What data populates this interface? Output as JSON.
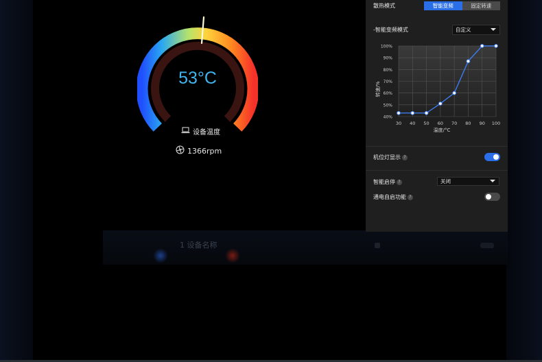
{
  "gauge": {
    "temperature": "53°C",
    "device_label": "设备温度",
    "fan_speed": "1366rpm",
    "level_fraction": 0.53,
    "icons": [
      "laptop-icon",
      "fan-icon"
    ]
  },
  "panel": {
    "cooling_mode_label": "散热模式",
    "mode_tabs": [
      {
        "label": "智能变频",
        "active": true
      },
      {
        "label": "固定转速",
        "active": false
      }
    ],
    "smart_mode_label": "-智能变频模式",
    "smart_mode_value": "自定义",
    "curve": {
      "type": "line",
      "x": [
        30,
        40,
        50,
        60,
        70,
        80,
        90,
        100
      ],
      "y": [
        43,
        43,
        43,
        51,
        60,
        87,
        100,
        100
      ],
      "x_ticks": [
        "30",
        "40",
        "50",
        "60",
        "70",
        "80",
        "90",
        "100"
      ],
      "y_ticks": [
        "100%",
        "90%",
        "80%",
        "70%",
        "60%",
        "50%",
        "40%"
      ],
      "xlabel": "温度/°C",
      "ylabel": "转速/%",
      "xlim": [
        30,
        100
      ],
      "ylim": [
        40,
        100
      ],
      "grid": true,
      "line_color": "#3d7cf0"
    },
    "light_label": "机位灯显示",
    "light_on": true,
    "smart_start_label": "智能启停",
    "smart_start_value": "关闭",
    "power_on_label": "通电自启功能",
    "power_on_on": false,
    "help_glyph": "?"
  },
  "background": {
    "ghost_text": "1 设备名称"
  },
  "colors": {
    "accent": "#2b6fe8",
    "temp_text": "#3fb4ee",
    "panel_bg": "#1f1f1f"
  }
}
